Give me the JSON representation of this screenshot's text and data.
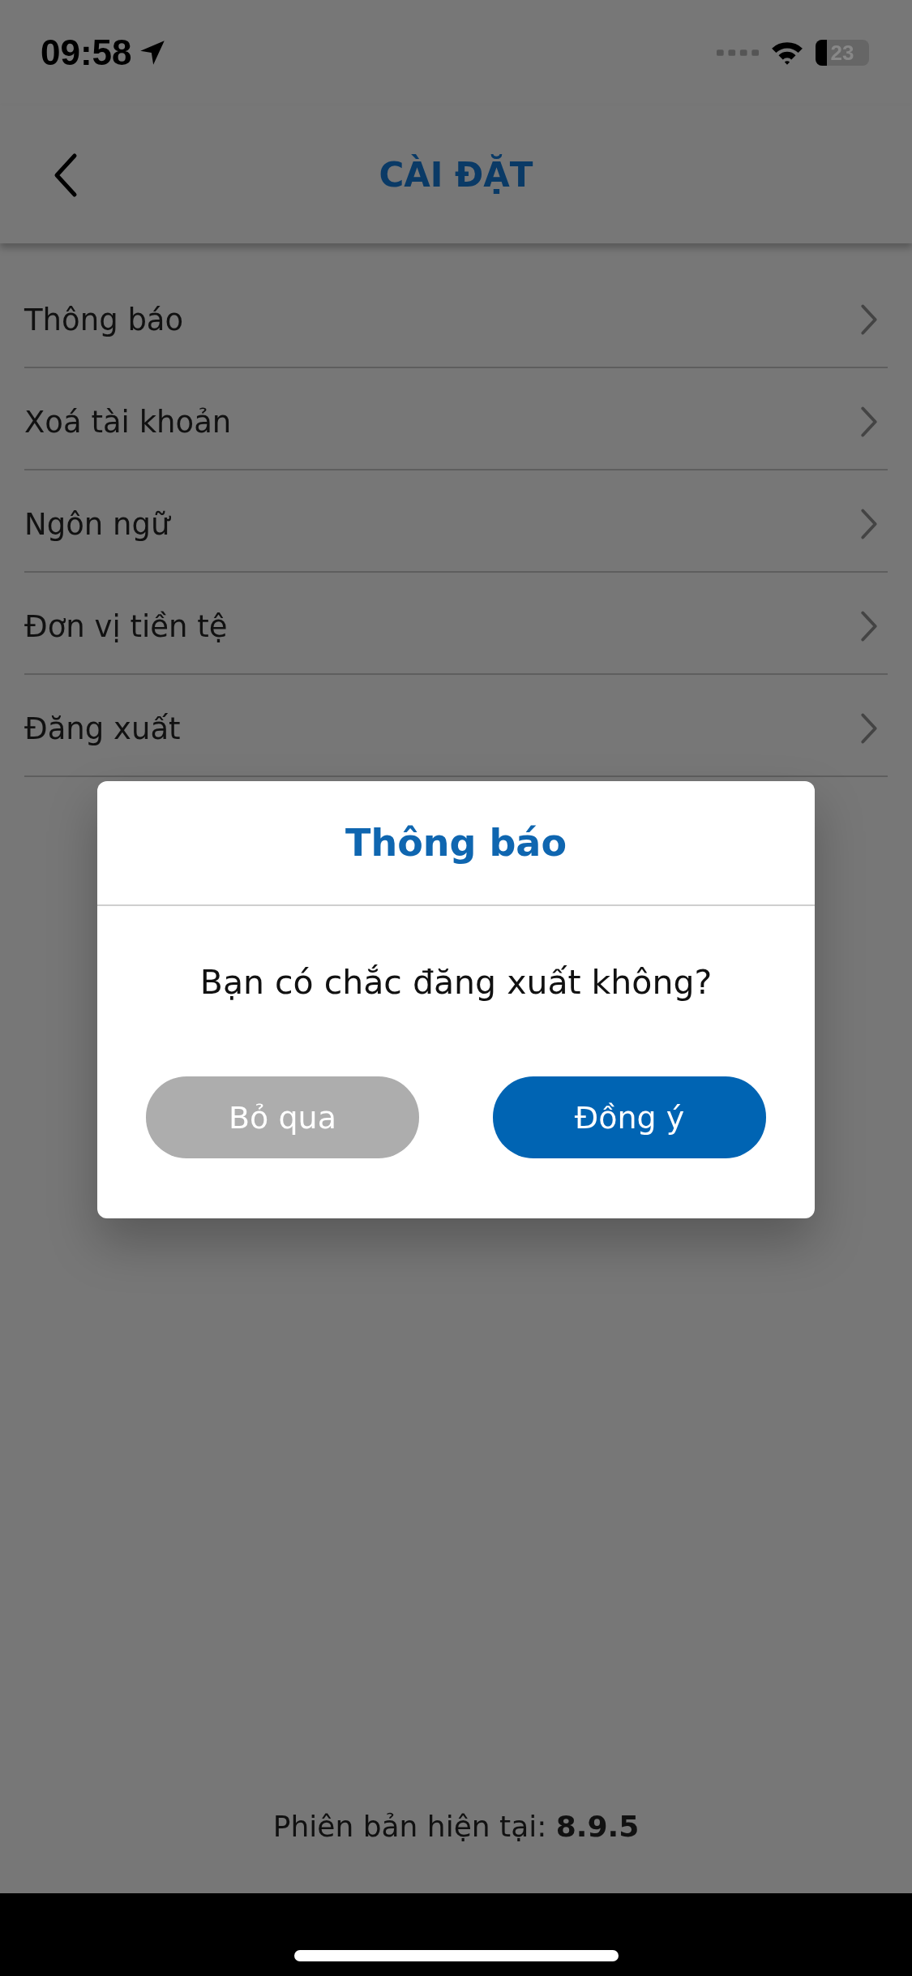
{
  "status_bar": {
    "time": "09:58",
    "battery": "23"
  },
  "header": {
    "title": "CÀI ĐẶT"
  },
  "settings": [
    {
      "label": "Thông báo"
    },
    {
      "label": "Xoá tài khoản"
    },
    {
      "label": "Ngôn ngữ"
    },
    {
      "label": "Đơn vị tiền tệ"
    },
    {
      "label": "Đăng xuất"
    }
  ],
  "dialog": {
    "title": "Thông báo",
    "message": "Bạn có chắc đăng xuất không?",
    "buttons": [
      {
        "label": "Bỏ qua",
        "kind": "secondary"
      },
      {
        "label": "Đồng ý",
        "kind": "primary"
      }
    ]
  },
  "footer": {
    "version": "Phiên bản hiện tại: **8.9.5**"
  }
}
